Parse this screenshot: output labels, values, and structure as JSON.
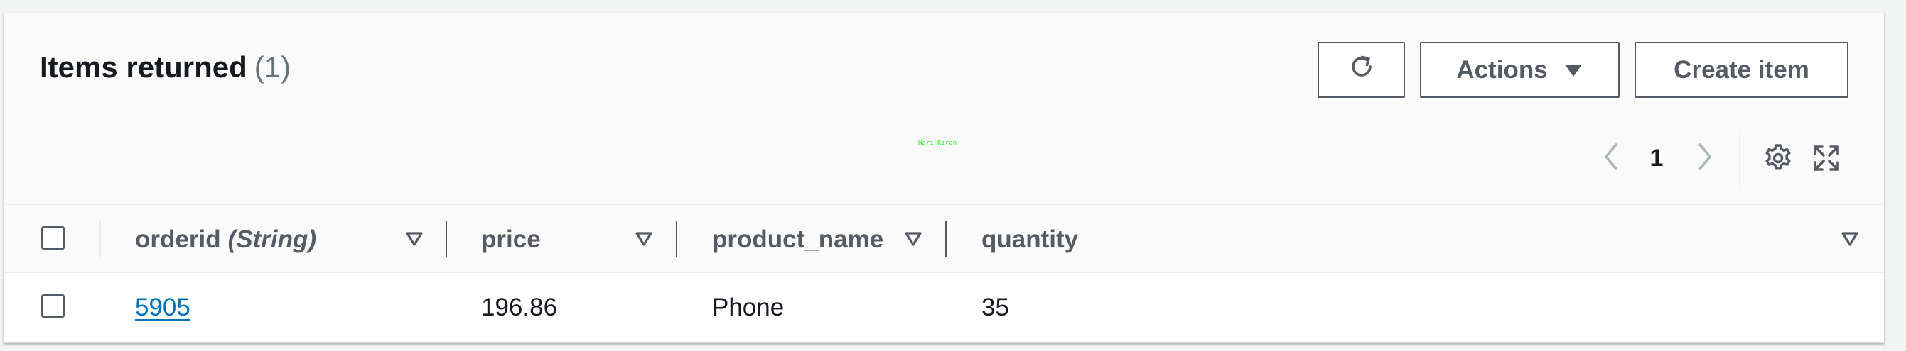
{
  "header": {
    "title": "Items returned",
    "count": "(1)"
  },
  "toolbar": {
    "refresh_icon": "refresh-icon",
    "actions_label": "Actions",
    "actions_icon": "caret-down-icon",
    "create_label": "Create item"
  },
  "watermark": "Hari Kiran",
  "pagination": {
    "current_page": "1",
    "prev_icon": "chevron-left-icon",
    "next_icon": "chevron-right-icon"
  },
  "utility_icons": [
    "settings-icon",
    "fullscreen-icon"
  ],
  "table": {
    "columns": [
      {
        "name": "orderid",
        "type": "(String)"
      },
      {
        "name": "price"
      },
      {
        "name": "product_name"
      },
      {
        "name": "quantity"
      }
    ],
    "rows": [
      {
        "orderid": "5905",
        "price": "196.86",
        "product_name": "Phone",
        "quantity": "35"
      }
    ]
  },
  "colors": {
    "link": "#0073bb",
    "text": "#16191f",
    "muted": "#545b64",
    "watermark": "#1aff1a"
  }
}
